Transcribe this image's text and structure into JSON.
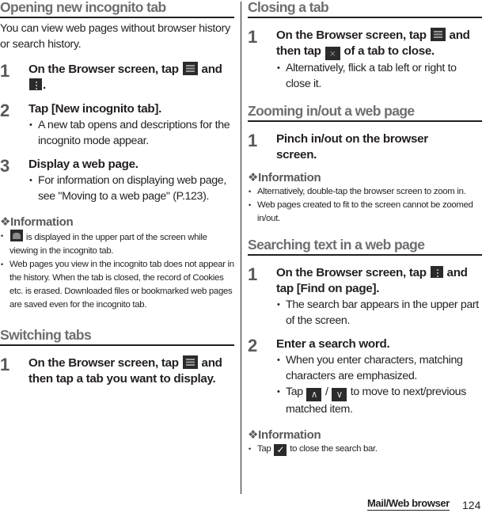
{
  "left": {
    "incognito": {
      "title": "Opening new incognito tab",
      "intro": "You can view web pages without browser history or search history.",
      "steps": [
        {
          "num": "1",
          "text_a": "On the Browser screen, tap",
          "text_b": "and",
          "text_c": "."
        },
        {
          "num": "2",
          "text": "Tap [New incognito tab].",
          "bullet": "A new tab opens and descriptions for the incognito mode appear."
        },
        {
          "num": "3",
          "text": "Display a web page.",
          "bullet": "For information on displaying web page, see \"Moving to a web page\" (P.123)."
        }
      ],
      "info": {
        "title": "❖Information",
        "items": [
          "is displayed in the upper part of the screen while viewing in the incognito tab.",
          "Web pages you view in the incognito tab does not appear in the history. When the tab is closed, the record of Cookies etc. is erased. Downloaded files or bookmarked web pages are saved even for the incognito tab."
        ]
      }
    },
    "switching": {
      "title": "Switching tabs",
      "steps": [
        {
          "num": "1",
          "text_a": "On the Browser screen, tap",
          "text_b": "and then tap a tab you want to display."
        }
      ]
    }
  },
  "right": {
    "closing": {
      "title": "Closing a tab",
      "steps": [
        {
          "num": "1",
          "text_a": "On the Browser screen, tap",
          "text_b": "and then tap",
          "text_c": "of a tab to close.",
          "bullet": "Alternatively, flick a tab left or right to close it."
        }
      ]
    },
    "zooming": {
      "title": "Zooming in/out a web page",
      "steps": [
        {
          "num": "1",
          "text": "Pinch in/out on the browser screen."
        }
      ],
      "info": {
        "title": "❖Information",
        "items": [
          "Alternatively, double-tap the browser screen to zoom in.",
          "Web pages created to fit to the screen cannot be zoomed in/out."
        ]
      }
    },
    "searching": {
      "title": "Searching text in a web page",
      "steps": [
        {
          "num": "1",
          "text_a": "On the Browser screen, tap",
          "text_b": "and tap [Find on page].",
          "bullet": "The search bar appears in the upper part of the screen."
        },
        {
          "num": "2",
          "text": "Enter a search word.",
          "bullets": [
            "When you enter characters, matching characters are emphasized.",
            {
              "a": "Tap",
              "b": "/",
              "c": "to move to next/previous matched item."
            }
          ]
        }
      ],
      "info": {
        "title": "❖Information",
        "items": [
          {
            "a": "Tap",
            "b": "to close the search bar."
          }
        ]
      }
    }
  },
  "icons": {
    "tabs": "≡",
    "menu": "⋮",
    "close": "×",
    "up": "∧",
    "down": "∨",
    "check": "✓"
  },
  "footer": {
    "section": "Mail/Web browser",
    "page": "124"
  }
}
